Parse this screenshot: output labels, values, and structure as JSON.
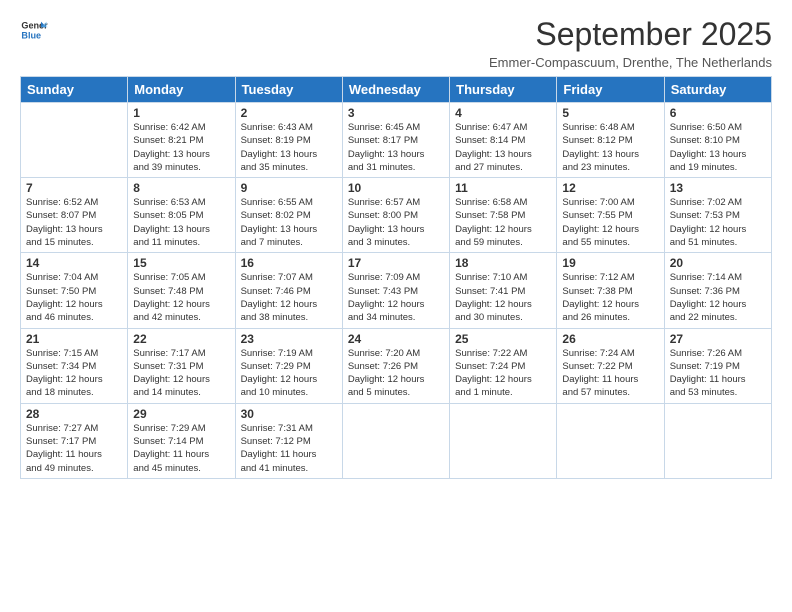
{
  "logo": {
    "line1": "General",
    "line2": "Blue"
  },
  "title": "September 2025",
  "subtitle": "Emmer-Compascuum, Drenthe, The Netherlands",
  "headers": [
    "Sunday",
    "Monday",
    "Tuesday",
    "Wednesday",
    "Thursday",
    "Friday",
    "Saturday"
  ],
  "weeks": [
    [
      {
        "day": "",
        "info": ""
      },
      {
        "day": "1",
        "info": "Sunrise: 6:42 AM\nSunset: 8:21 PM\nDaylight: 13 hours\nand 39 minutes."
      },
      {
        "day": "2",
        "info": "Sunrise: 6:43 AM\nSunset: 8:19 PM\nDaylight: 13 hours\nand 35 minutes."
      },
      {
        "day": "3",
        "info": "Sunrise: 6:45 AM\nSunset: 8:17 PM\nDaylight: 13 hours\nand 31 minutes."
      },
      {
        "day": "4",
        "info": "Sunrise: 6:47 AM\nSunset: 8:14 PM\nDaylight: 13 hours\nand 27 minutes."
      },
      {
        "day": "5",
        "info": "Sunrise: 6:48 AM\nSunset: 8:12 PM\nDaylight: 13 hours\nand 23 minutes."
      },
      {
        "day": "6",
        "info": "Sunrise: 6:50 AM\nSunset: 8:10 PM\nDaylight: 13 hours\nand 19 minutes."
      }
    ],
    [
      {
        "day": "7",
        "info": "Sunrise: 6:52 AM\nSunset: 8:07 PM\nDaylight: 13 hours\nand 15 minutes."
      },
      {
        "day": "8",
        "info": "Sunrise: 6:53 AM\nSunset: 8:05 PM\nDaylight: 13 hours\nand 11 minutes."
      },
      {
        "day": "9",
        "info": "Sunrise: 6:55 AM\nSunset: 8:02 PM\nDaylight: 13 hours\nand 7 minutes."
      },
      {
        "day": "10",
        "info": "Sunrise: 6:57 AM\nSunset: 8:00 PM\nDaylight: 13 hours\nand 3 minutes."
      },
      {
        "day": "11",
        "info": "Sunrise: 6:58 AM\nSunset: 7:58 PM\nDaylight: 12 hours\nand 59 minutes."
      },
      {
        "day": "12",
        "info": "Sunrise: 7:00 AM\nSunset: 7:55 PM\nDaylight: 12 hours\nand 55 minutes."
      },
      {
        "day": "13",
        "info": "Sunrise: 7:02 AM\nSunset: 7:53 PM\nDaylight: 12 hours\nand 51 minutes."
      }
    ],
    [
      {
        "day": "14",
        "info": "Sunrise: 7:04 AM\nSunset: 7:50 PM\nDaylight: 12 hours\nand 46 minutes."
      },
      {
        "day": "15",
        "info": "Sunrise: 7:05 AM\nSunset: 7:48 PM\nDaylight: 12 hours\nand 42 minutes."
      },
      {
        "day": "16",
        "info": "Sunrise: 7:07 AM\nSunset: 7:46 PM\nDaylight: 12 hours\nand 38 minutes."
      },
      {
        "day": "17",
        "info": "Sunrise: 7:09 AM\nSunset: 7:43 PM\nDaylight: 12 hours\nand 34 minutes."
      },
      {
        "day": "18",
        "info": "Sunrise: 7:10 AM\nSunset: 7:41 PM\nDaylight: 12 hours\nand 30 minutes."
      },
      {
        "day": "19",
        "info": "Sunrise: 7:12 AM\nSunset: 7:38 PM\nDaylight: 12 hours\nand 26 minutes."
      },
      {
        "day": "20",
        "info": "Sunrise: 7:14 AM\nSunset: 7:36 PM\nDaylight: 12 hours\nand 22 minutes."
      }
    ],
    [
      {
        "day": "21",
        "info": "Sunrise: 7:15 AM\nSunset: 7:34 PM\nDaylight: 12 hours\nand 18 minutes."
      },
      {
        "day": "22",
        "info": "Sunrise: 7:17 AM\nSunset: 7:31 PM\nDaylight: 12 hours\nand 14 minutes."
      },
      {
        "day": "23",
        "info": "Sunrise: 7:19 AM\nSunset: 7:29 PM\nDaylight: 12 hours\nand 10 minutes."
      },
      {
        "day": "24",
        "info": "Sunrise: 7:20 AM\nSunset: 7:26 PM\nDaylight: 12 hours\nand 5 minutes."
      },
      {
        "day": "25",
        "info": "Sunrise: 7:22 AM\nSunset: 7:24 PM\nDaylight: 12 hours\nand 1 minute."
      },
      {
        "day": "26",
        "info": "Sunrise: 7:24 AM\nSunset: 7:22 PM\nDaylight: 11 hours\nand 57 minutes."
      },
      {
        "day": "27",
        "info": "Sunrise: 7:26 AM\nSunset: 7:19 PM\nDaylight: 11 hours\nand 53 minutes."
      }
    ],
    [
      {
        "day": "28",
        "info": "Sunrise: 7:27 AM\nSunset: 7:17 PM\nDaylight: 11 hours\nand 49 minutes."
      },
      {
        "day": "29",
        "info": "Sunrise: 7:29 AM\nSunset: 7:14 PM\nDaylight: 11 hours\nand 45 minutes."
      },
      {
        "day": "30",
        "info": "Sunrise: 7:31 AM\nSunset: 7:12 PM\nDaylight: 11 hours\nand 41 minutes."
      },
      {
        "day": "",
        "info": ""
      },
      {
        "day": "",
        "info": ""
      },
      {
        "day": "",
        "info": ""
      },
      {
        "day": "",
        "info": ""
      }
    ]
  ]
}
